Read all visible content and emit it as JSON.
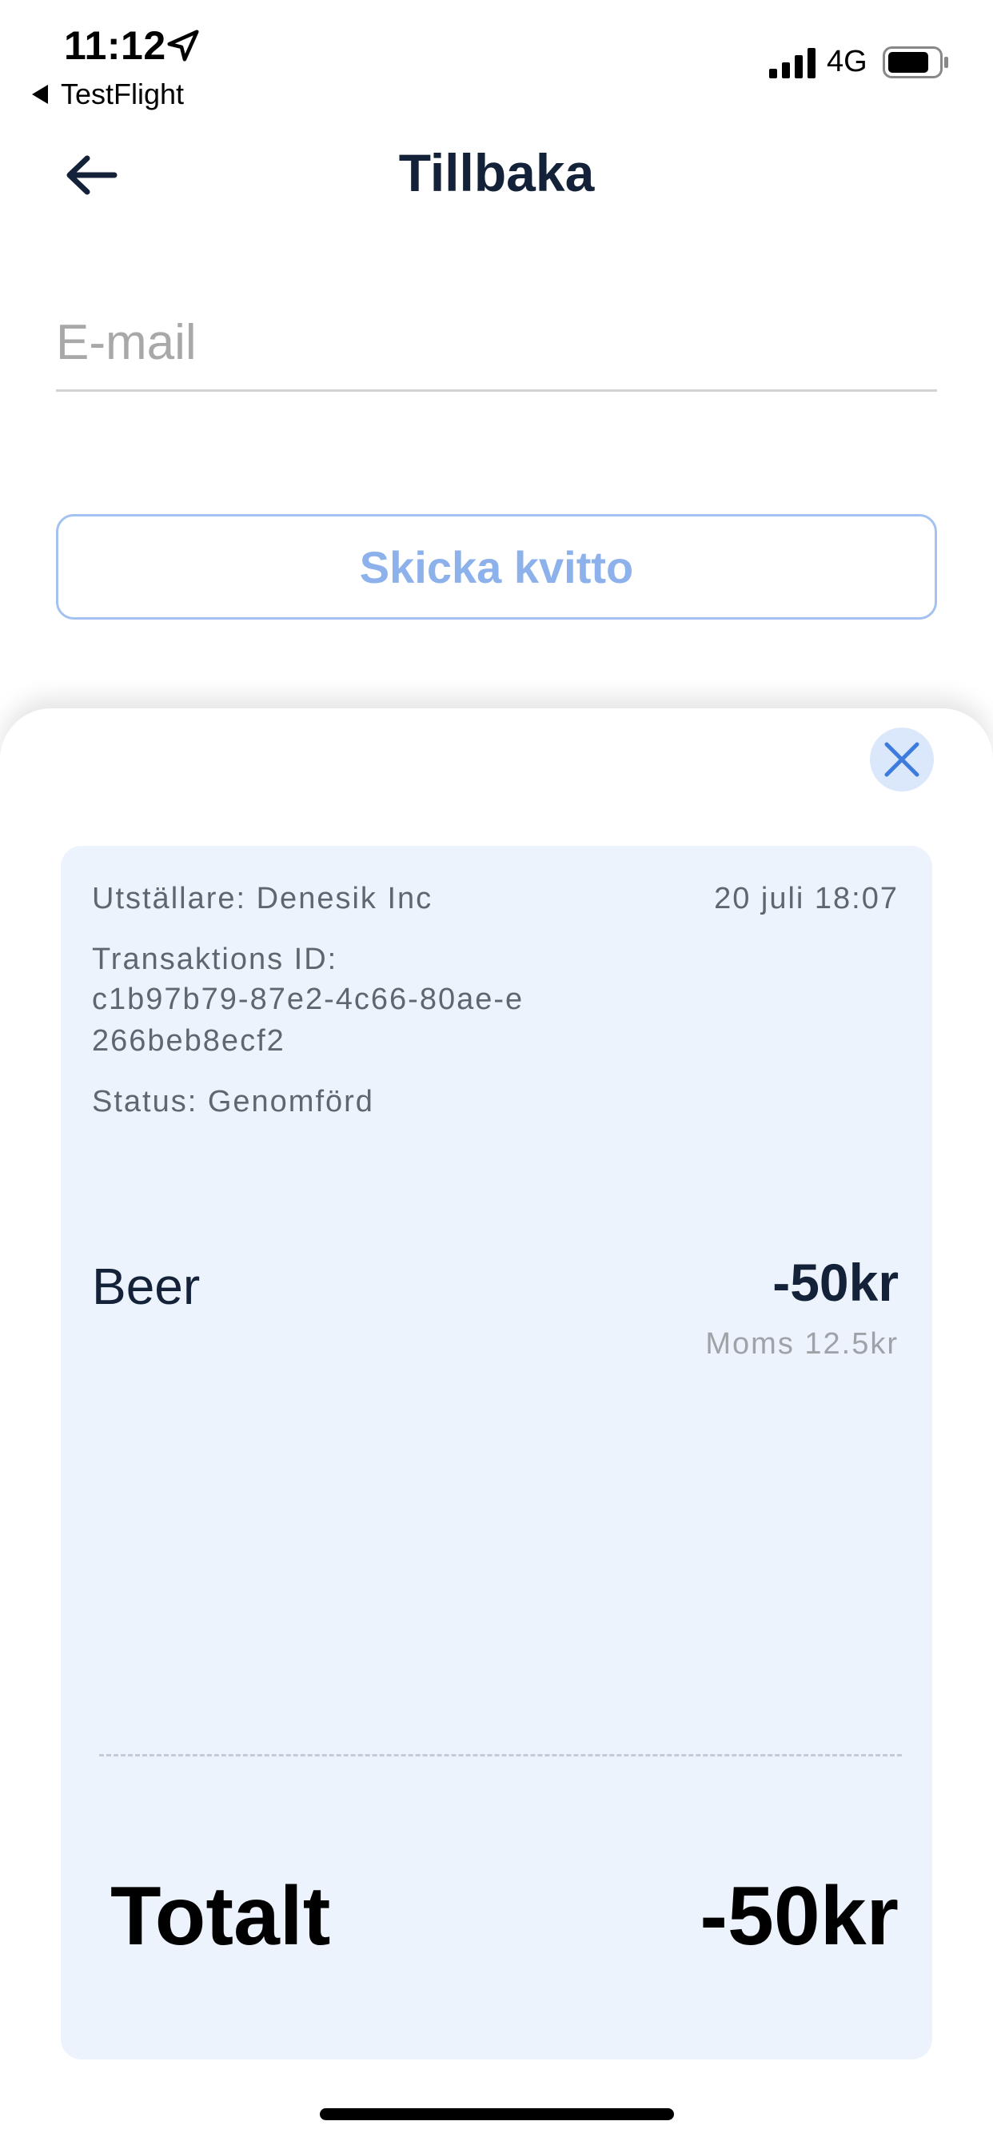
{
  "status_bar": {
    "time": "11:12",
    "back_app": "TestFlight",
    "network": "4G"
  },
  "nav": {
    "title": "Tillbaka"
  },
  "email": {
    "placeholder": "E-mail",
    "value": ""
  },
  "send_button": {
    "label": "Skicka kvitto"
  },
  "receipt": {
    "issuer": "Utställare: Denesik Inc",
    "date": "20 juli 18:07",
    "transaction_label": "Transaktions ID:",
    "transaction_id": "c1b97b79-87e2-4c66-80ae-e266beb8ecf2",
    "status": "Status: Genomförd",
    "items": [
      {
        "name": "Beer",
        "price": "-50kr",
        "vat": "Moms 12.5kr"
      }
    ],
    "total_label": "Totalt",
    "total_value": "-50kr"
  },
  "colors": {
    "accent": "#3d7bdc",
    "button_text": "#8db1ea",
    "card_bg": "#edf3fd",
    "title": "#132238"
  },
  "icons": {
    "back": "arrow-left-icon",
    "close": "close-icon",
    "location": "location-arrow-icon"
  }
}
